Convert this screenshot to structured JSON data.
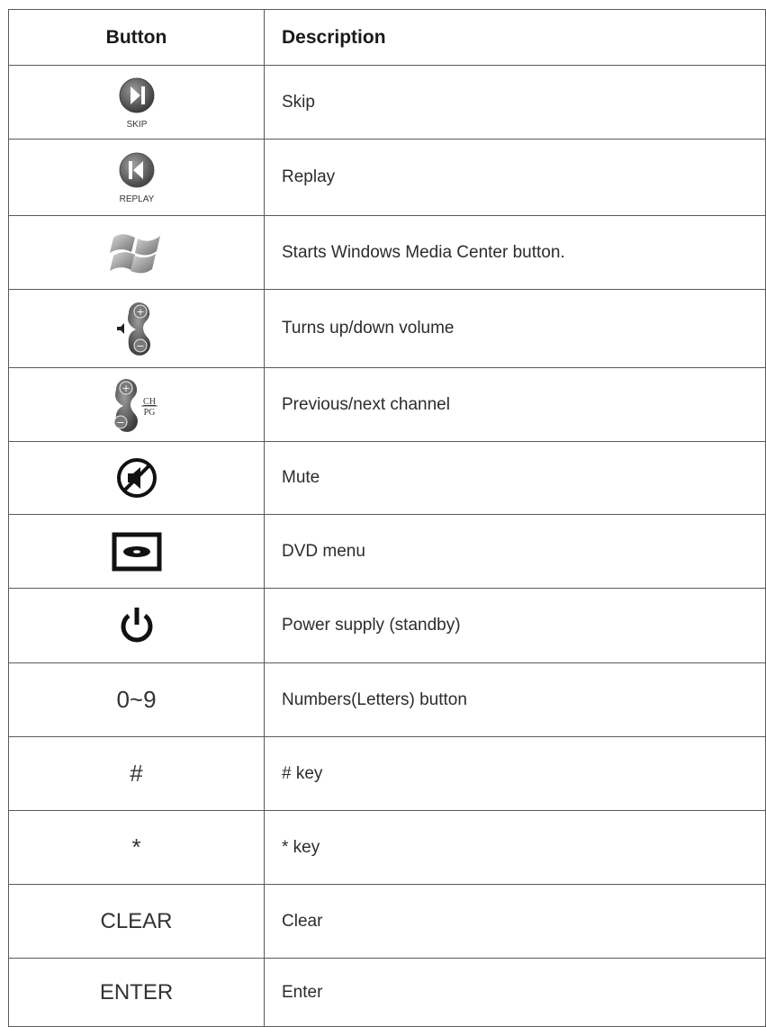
{
  "header": {
    "button_label": "Button",
    "description_label": "Description"
  },
  "rows": [
    {
      "icon": "skip-icon",
      "icon_caption": "SKIP",
      "description": "Skip"
    },
    {
      "icon": "replay-icon",
      "icon_caption": "REPLAY",
      "description": "Replay"
    },
    {
      "icon": "windows-logo-icon",
      "description": "Starts Windows Media Center button."
    },
    {
      "icon": "volume-rocker-icon",
      "plus": "+",
      "minus": "−",
      "description": "Turns up/down volume"
    },
    {
      "icon": "channel-rocker-icon",
      "plus": "+",
      "minus": "−",
      "ch": "CH",
      "pg": "PG",
      "description": "Previous/next channel"
    },
    {
      "icon": "mute-icon",
      "description": "Mute"
    },
    {
      "icon": "dvd-menu-icon",
      "description": "DVD menu"
    },
    {
      "icon": "power-icon",
      "description": "Power supply (standby)"
    },
    {
      "button_text": "0~9",
      "description": "Numbers(Letters) button"
    },
    {
      "button_text": "#",
      "description": "# key"
    },
    {
      "button_text": "*",
      "description": "* key"
    },
    {
      "button_text": "CLEAR",
      "description": "Clear"
    },
    {
      "button_text": "ENTER",
      "description": "Enter"
    }
  ]
}
